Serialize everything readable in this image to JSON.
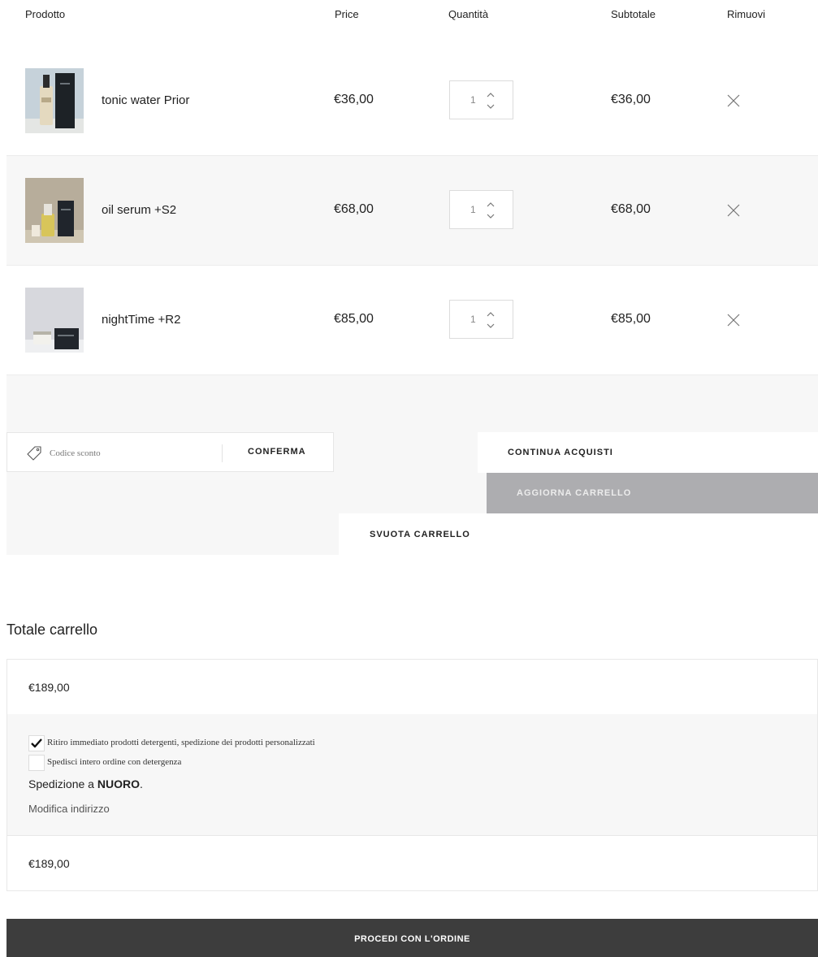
{
  "table_header": {
    "product": "Prodotto",
    "price": "Price",
    "quantity": "Quantità",
    "subtotal": "Subtotale",
    "remove": "Rimuovi"
  },
  "items": [
    {
      "name": "tonic water Prior",
      "price": "€36,00",
      "quantity": "1",
      "subtotal": "€36,00"
    },
    {
      "name": "oil serum +S2",
      "price": "€68,00",
      "quantity": "1",
      "subtotal": "€68,00"
    },
    {
      "name": "nightTime +R2",
      "price": "€85,00",
      "quantity": "1",
      "subtotal": "€85,00"
    }
  ],
  "coupon": {
    "placeholder": "Codice sconto",
    "button": "CONFERMA",
    "icon": "tag-icon"
  },
  "actions": {
    "continue": "CONTINUA ACQUISTI",
    "update": "AGGIORNA CARRELLO",
    "empty": "SVUOTA CARRELLO"
  },
  "totals": {
    "title": "Totale carrello",
    "subtotal": "€189,00",
    "shipping_options": [
      {
        "label": "Ritiro immediato prodotti detergenti, spedizione dei prodotti personalizzati",
        "checked": true
      },
      {
        "label": "Spedisci intero ordine con detergenza",
        "checked": false
      }
    ],
    "ship_to_prefix": "Spedizione a ",
    "ship_to_city": "NUORO",
    "ship_to_suffix": ".",
    "modify_address": "Modifica indirizzo",
    "total": "€189,00"
  },
  "checkout": "PROCEDI CON L'ORDINE",
  "colors": {
    "row_alt_bg": "#f7f7f7",
    "update_btn_bg": "#adadb0",
    "checkout_bg": "#3d3d3d"
  }
}
